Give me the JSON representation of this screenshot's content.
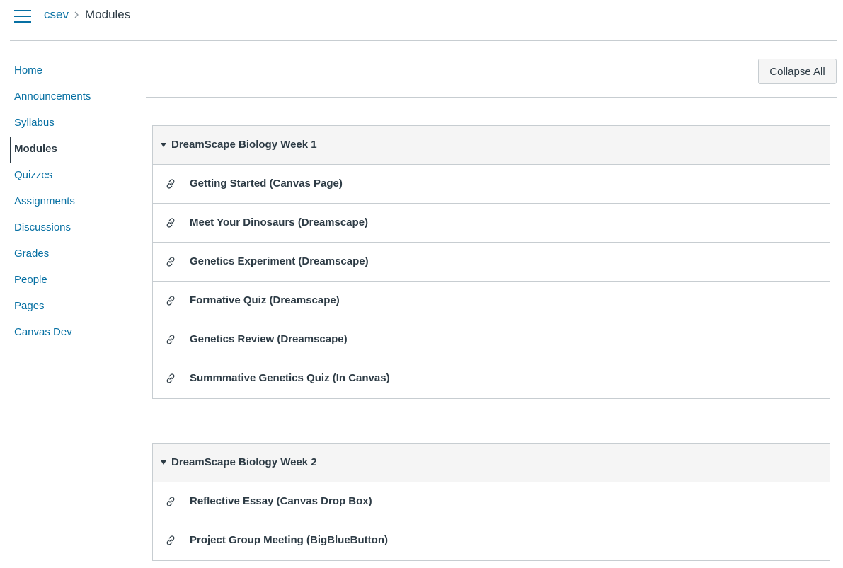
{
  "breadcrumb": {
    "course": "csev",
    "current": "Modules"
  },
  "nav": {
    "items": [
      {
        "label": "Home"
      },
      {
        "label": "Announcements"
      },
      {
        "label": "Syllabus"
      },
      {
        "label": "Modules",
        "active": true
      },
      {
        "label": "Quizzes"
      },
      {
        "label": "Assignments"
      },
      {
        "label": "Discussions"
      },
      {
        "label": "Grades"
      },
      {
        "label": "People"
      },
      {
        "label": "Pages"
      },
      {
        "label": "Canvas Dev"
      }
    ]
  },
  "toolbar": {
    "collapse_all_label": "Collapse All"
  },
  "modules": [
    {
      "title": "DreamScape Biology Week 1",
      "items": [
        {
          "title": "Getting Started (Canvas Page)",
          "icon": "link-icon"
        },
        {
          "title": "Meet Your Dinosaurs (Dreamscape)",
          "icon": "link-icon"
        },
        {
          "title": "Genetics Experiment (Dreamscape)",
          "icon": "link-icon"
        },
        {
          "title": "Formative Quiz (Dreamscape)",
          "icon": "link-icon"
        },
        {
          "title": "Genetics Review (Dreamscape)",
          "icon": "link-icon"
        },
        {
          "title": "Summmative Genetics Quiz (In Canvas)",
          "icon": "link-icon"
        }
      ]
    },
    {
      "title": "DreamScape Biology Week 2",
      "items": [
        {
          "title": "Reflective Essay (Canvas Drop Box)",
          "icon": "link-icon"
        },
        {
          "title": "Project Group Meeting (BigBlueButton)",
          "icon": "link-icon"
        }
      ]
    }
  ],
  "colors": {
    "link": "#0770a3",
    "text": "#2d3b45",
    "border": "#c7cdd1",
    "header_bg": "#f5f5f5"
  }
}
